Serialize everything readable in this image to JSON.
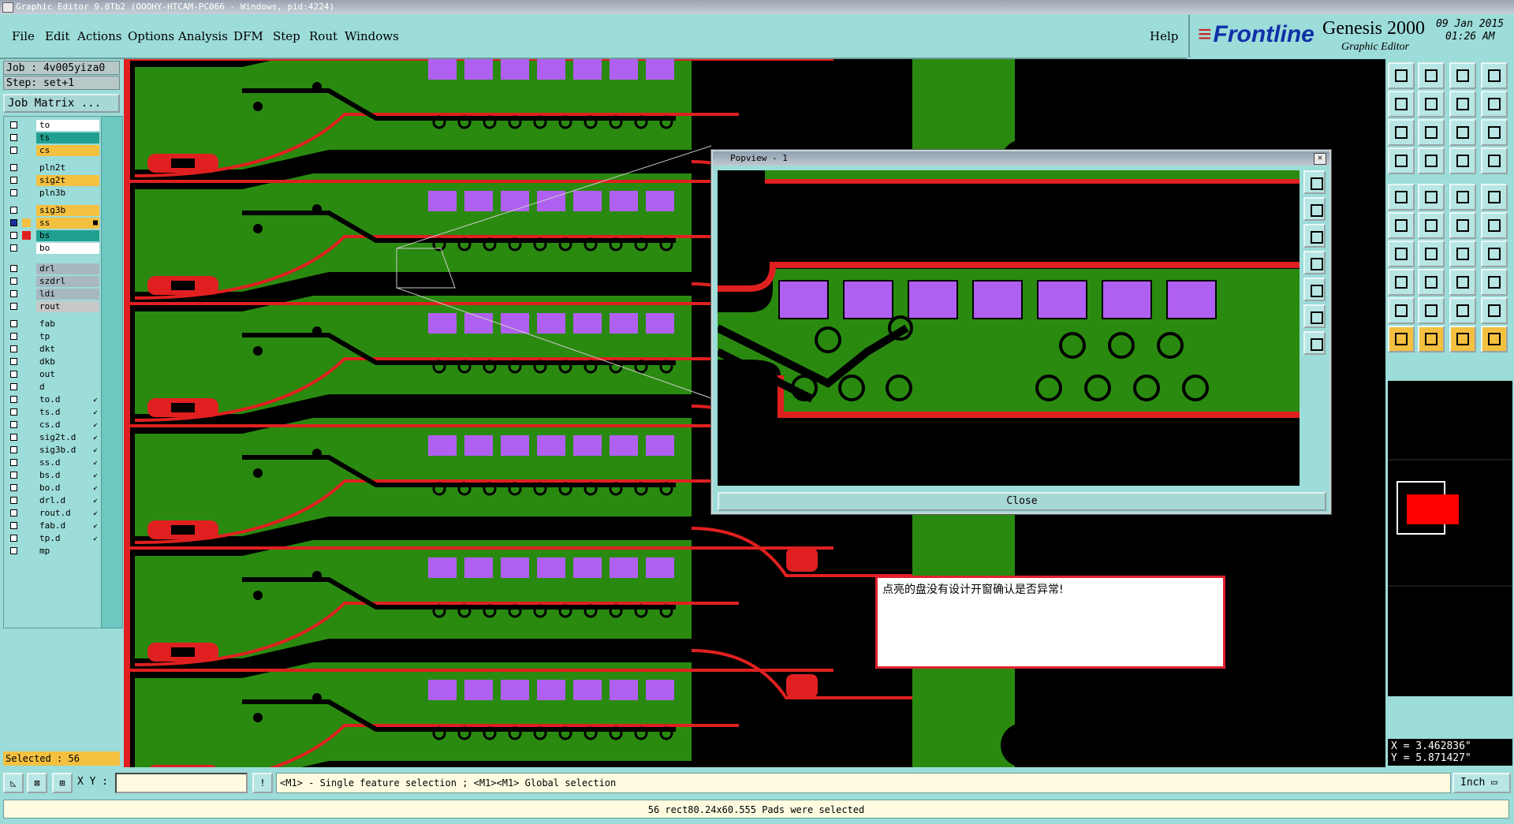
{
  "window": {
    "title": "Graphic Editor 9.0Tb2 (OOOHY-HTCAM-PC066 - Windows, pid:4224)"
  },
  "menu": {
    "items": [
      "File",
      "Edit",
      "Actions",
      "Options",
      "Analysis",
      "DFM",
      "Step",
      "Rout",
      "Windows"
    ],
    "help": "Help"
  },
  "brand": {
    "logo": "Frontline",
    "product": "Genesis 2000",
    "subtitle": "Graphic Editor",
    "date": "09 Jan 2015",
    "time": "01:26 AM"
  },
  "job": {
    "job_label": "Job : 4v005yiza0",
    "step_label": "Step: set+1",
    "matrix_button": "Job Matrix ..."
  },
  "layers": [
    {
      "name": "to",
      "color": "#ffffff",
      "selected": false,
      "mark": ""
    },
    {
      "name": "ts",
      "color": "#20a090",
      "selected": false,
      "mark": ""
    },
    {
      "name": "cs",
      "color": "#f4c040",
      "selected": false,
      "mark": ""
    },
    {
      "name": "pln2t",
      "color": "#9cdcd9",
      "selected": false,
      "mark": ""
    },
    {
      "name": "sig2t",
      "color": "#f4c040",
      "selected": false,
      "mark": ""
    },
    {
      "name": "pln3b",
      "color": "#9cdcd9",
      "selected": false,
      "mark": ""
    },
    {
      "name": "sig3b",
      "color": "#f4c040",
      "selected": false,
      "mark": ""
    },
    {
      "name": "ss",
      "color": "#f4c040",
      "selected": true,
      "mark": "■"
    },
    {
      "name": "bs",
      "color": "#20a090",
      "selected": false,
      "mark": ""
    },
    {
      "name": "bo",
      "color": "#ffffff",
      "selected": false,
      "mark": ""
    },
    {
      "name": "drl",
      "color": "#a8b8c0",
      "selected": false,
      "mark": ""
    },
    {
      "name": "szdrl",
      "color": "#a8b8c0",
      "selected": false,
      "mark": ""
    },
    {
      "name": "ldi",
      "color": "#a8b8c0",
      "selected": false,
      "mark": ""
    },
    {
      "name": "rout",
      "color": "#c8c8c8",
      "selected": false,
      "mark": ""
    },
    {
      "name": "fab",
      "color": "#9cdcd9",
      "selected": false,
      "mark": ""
    },
    {
      "name": "tp",
      "color": "#9cdcd9",
      "selected": false,
      "mark": ""
    },
    {
      "name": "dkt",
      "color": "#9cdcd9",
      "selected": false,
      "mark": ""
    },
    {
      "name": "dkb",
      "color": "#9cdcd9",
      "selected": false,
      "mark": ""
    },
    {
      "name": "out",
      "color": "#9cdcd9",
      "selected": false,
      "mark": ""
    },
    {
      "name": "d",
      "color": "#9cdcd9",
      "selected": false,
      "mark": ""
    },
    {
      "name": "to.d",
      "color": "#9cdcd9",
      "selected": false,
      "mark": "↙"
    },
    {
      "name": "ts.d",
      "color": "#9cdcd9",
      "selected": false,
      "mark": "↙"
    },
    {
      "name": "cs.d",
      "color": "#9cdcd9",
      "selected": false,
      "mark": "↙"
    },
    {
      "name": "sig2t.d",
      "color": "#9cdcd9",
      "selected": false,
      "mark": "↙"
    },
    {
      "name": "sig3b.d",
      "color": "#9cdcd9",
      "selected": false,
      "mark": "↙"
    },
    {
      "name": "ss.d",
      "color": "#9cdcd9",
      "selected": false,
      "mark": "↙"
    },
    {
      "name": "bs.d",
      "color": "#9cdcd9",
      "selected": false,
      "mark": "↙"
    },
    {
      "name": "bo.d",
      "color": "#9cdcd9",
      "selected": false,
      "mark": "↙"
    },
    {
      "name": "drl.d",
      "color": "#9cdcd9",
      "selected": false,
      "mark": "↙"
    },
    {
      "name": "rout.d",
      "color": "#9cdcd9",
      "selected": false,
      "mark": "↙"
    },
    {
      "name": "fab.d",
      "color": "#9cdcd9",
      "selected": false,
      "mark": "↙"
    },
    {
      "name": "tp.d",
      "color": "#9cdcd9",
      "selected": false,
      "mark": "↙"
    },
    {
      "name": "mp",
      "color": "#9cdcd9",
      "selected": false,
      "mark": ""
    }
  ],
  "selected_count": "Selected : 56",
  "popview": {
    "title": "Popview - 1",
    "close_label": "Close"
  },
  "message": "点亮的盘没有设计开窗确认是否异常!",
  "coords": {
    "x": "X = 3.462836\"",
    "y": "Y = 5.871427\""
  },
  "bottom": {
    "xy_label": "X Y :",
    "hint": "<M1> - Single feature selection ; <M1><M1> Global selection",
    "units": "Inch"
  },
  "status": "56 rect80.24x60.555 Pads were selected",
  "colors": {
    "copper": "#2a8a10",
    "trace": "#e02020",
    "pad": "#b060f0",
    "background": "#000000",
    "panel": "#9cdcd9"
  }
}
